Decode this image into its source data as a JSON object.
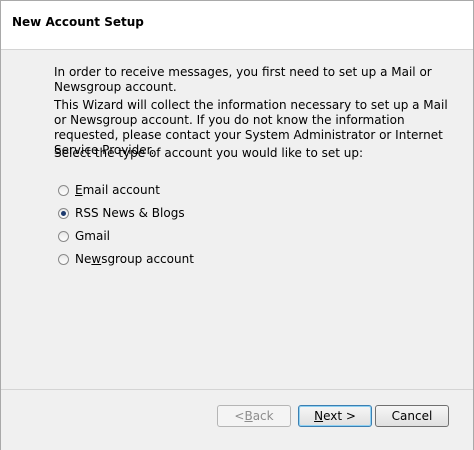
{
  "window": {
    "title": "New Account Setup"
  },
  "intro": {
    "paragraph1": "In order to receive messages, you first need to set up a Mail or Newsgroup account.",
    "paragraph2": "This Wizard will collect the information necessary to set up a Mail or Newsgroup account. If you do not know the information requested, please contact your System Administrator or Internet Service Provider.",
    "prompt": "Select the type of account you would like to set up:"
  },
  "account_types": [
    {
      "label": "Email account",
      "accesskey": "E",
      "rest": "mail account",
      "selected": false
    },
    {
      "label": "RSS News & Blogs",
      "accesskey": "",
      "rest": "RSS News & Blogs",
      "selected": true
    },
    {
      "label": "Gmail",
      "accesskey": "",
      "rest": "Gmail",
      "selected": false
    },
    {
      "label": "Newsgroup account",
      "accesskey": "",
      "rest": "Newsgroup account",
      "selected": false
    }
  ],
  "buttons": {
    "back_prefix": "< ",
    "back_key": "B",
    "back_rest": "ack",
    "next_key": "N",
    "next_rest": "ext >",
    "cancel": "Cancel"
  }
}
